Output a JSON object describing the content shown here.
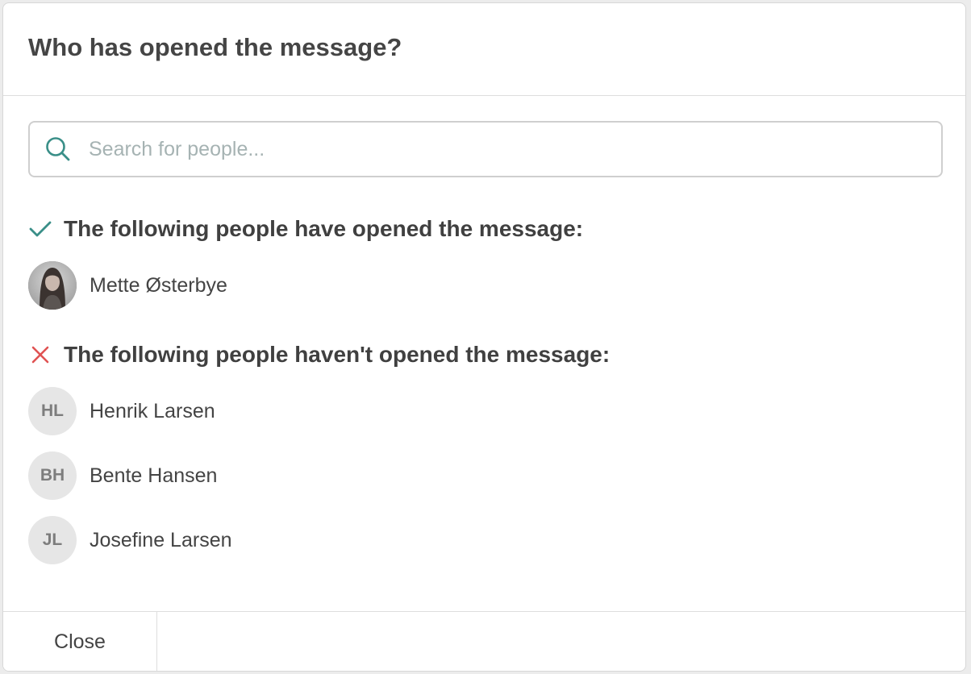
{
  "dialog": {
    "title": "Who has opened the message?",
    "close_label": "Close"
  },
  "search": {
    "placeholder": "Search for people...",
    "value": ""
  },
  "opened": {
    "heading": "The following people have opened the message:",
    "icon": "check-icon",
    "icon_color": "#3a8f88",
    "people": [
      {
        "name": "Mette Østerbye",
        "avatar": "photo"
      }
    ]
  },
  "not_opened": {
    "heading": "The following people haven't opened the message:",
    "icon": "x-icon",
    "icon_color": "#e05252",
    "people": [
      {
        "name": "Henrik Larsen",
        "initials": "HL"
      },
      {
        "name": "Bente Hansen",
        "initials": "BH"
      },
      {
        "name": "Josefine Larsen",
        "initials": "JL"
      }
    ]
  },
  "colors": {
    "accent": "#3a8f88",
    "error": "#e05252",
    "avatar_bg": "#e6e6e6"
  }
}
